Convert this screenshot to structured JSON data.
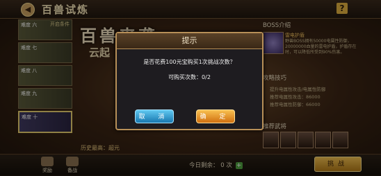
{
  "header": {
    "title": "百兽试炼",
    "back_icon": "back-arrow-icon",
    "help_label": "?"
  },
  "stages": [
    {
      "label": "难度 六",
      "tag": "开启条件"
    },
    {
      "label": "难度 七",
      "tag": ""
    },
    {
      "label": "难度 八",
      "tag": ""
    },
    {
      "label": "难度 九",
      "tag": ""
    },
    {
      "label": "难度 十",
      "tag": ""
    }
  ],
  "art": {
    "title": "百兽来袭",
    "subtitle": "云起"
  },
  "boss": {
    "section_title": "BOSS介绍",
    "name": "雷电护盾",
    "description": "野兽BOSS拥有50000电属性防御，20000000血量的雷电护盾，护盾存在时，可以降低所受到90%伤害。"
  },
  "tips": {
    "section_title": "攻略技巧",
    "lines": [
      "提升电属性攻击/电属性防御",
      "推荐电属性攻击：86000",
      "推荐电属性防御：66000"
    ]
  },
  "heroes": {
    "section_title": "推荐武将"
  },
  "bottom": {
    "boss_caption": "历史最高：超元",
    "reward_label": "奖励",
    "army_label": "备战",
    "remain_label": "今日剩余：",
    "remain_value": "0",
    "remain_unit": "次",
    "plus_label": "+",
    "challenge_label": "挑战"
  },
  "dialog": {
    "title": "提示",
    "message": "是否花费100元宝购买1次挑战次数？",
    "count_label": "可购买次数：0/2",
    "cancel_label": "取 消",
    "confirm_label": "确 定"
  }
}
